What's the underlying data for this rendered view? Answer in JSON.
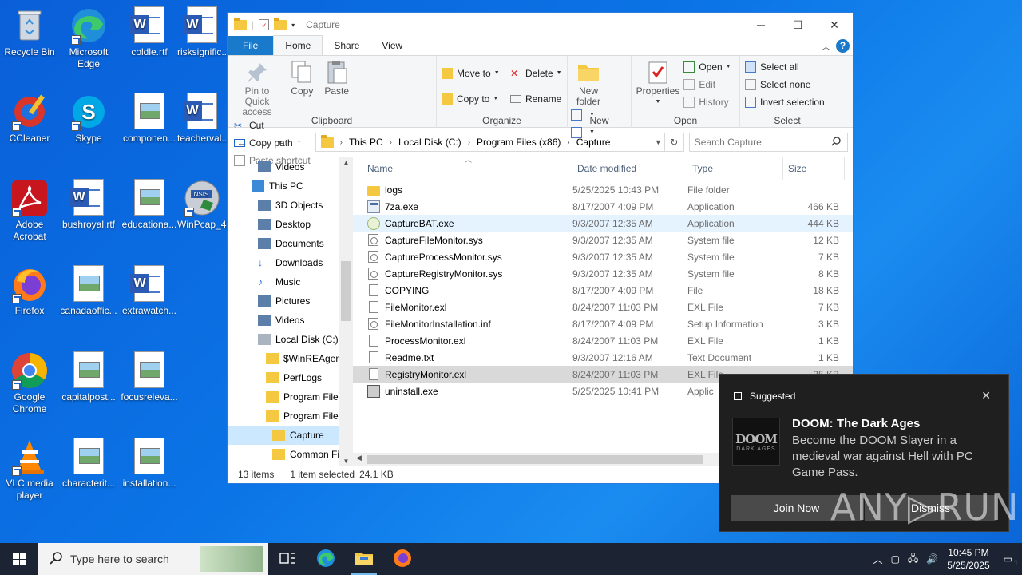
{
  "desktop": {
    "icons": [
      {
        "label": "Recycle Bin"
      },
      {
        "label": "Microsoft Edge"
      },
      {
        "label": "coldle.rtf"
      },
      {
        "label": "risksignific..."
      },
      {
        "label": "CCleaner"
      },
      {
        "label": "Skype"
      },
      {
        "label": "componen..."
      },
      {
        "label": "teacherval..."
      },
      {
        "label": "Adobe Acrobat"
      },
      {
        "label": "bushroyal.rtf"
      },
      {
        "label": "educationa..."
      },
      {
        "label": "WinPcap_4..."
      },
      {
        "label": "Firefox"
      },
      {
        "label": "canadaoffic..."
      },
      {
        "label": "extrawatch..."
      },
      {
        "label": "Google Chrome"
      },
      {
        "label": "capitalpost..."
      },
      {
        "label": "focusreleva..."
      },
      {
        "label": "VLC media player"
      },
      {
        "label": "characterit..."
      },
      {
        "label": "installation..."
      }
    ]
  },
  "explorer": {
    "title": "Capture",
    "tabs": [
      "File",
      "Home",
      "Share",
      "View"
    ],
    "ribbon": {
      "clipboard": {
        "name": "Clipboard",
        "pin": "Pin to Quick access",
        "copy": "Copy",
        "paste": "Paste",
        "cut": "Cut",
        "copy_path": "Copy path",
        "paste_shortcut": "Paste shortcut"
      },
      "organize": {
        "name": "Organize",
        "move_to": "Move to",
        "copy_to": "Copy to",
        "delete": "Delete",
        "rename": "Rename"
      },
      "new": {
        "name": "New",
        "new_folder": "New folder"
      },
      "open": {
        "name": "Open",
        "properties": "Properties",
        "open": "Open",
        "edit": "Edit",
        "history": "History"
      },
      "select": {
        "name": "Select",
        "select_all": "Select all",
        "select_none": "Select none",
        "invert": "Invert selection"
      }
    },
    "address": {
      "crumbs": [
        "This PC",
        "Local Disk (C:)",
        "Program Files (x86)",
        "Capture"
      ],
      "search_placeholder": "Search Capture"
    },
    "nav": [
      {
        "label": "Videos",
        "indent": 1
      },
      {
        "label": "This PC",
        "indent": 0
      },
      {
        "label": "3D Objects",
        "indent": 1
      },
      {
        "label": "Desktop",
        "indent": 1
      },
      {
        "label": "Documents",
        "indent": 1
      },
      {
        "label": "Downloads",
        "indent": 1
      },
      {
        "label": "Music",
        "indent": 1
      },
      {
        "label": "Pictures",
        "indent": 1
      },
      {
        "label": "Videos",
        "indent": 1
      },
      {
        "label": "Local Disk (C:)",
        "indent": 1
      },
      {
        "label": "$WinREAgent",
        "indent": 2
      },
      {
        "label": "PerfLogs",
        "indent": 2
      },
      {
        "label": "Program Files",
        "indent": 2
      },
      {
        "label": "Program Files",
        "indent": 2
      },
      {
        "label": "Capture",
        "indent": 3
      },
      {
        "label": "Common Fi",
        "indent": 3
      }
    ],
    "columns": {
      "name": "Name",
      "date": "Date modified",
      "type": "Type",
      "size": "Size"
    },
    "files": [
      {
        "name": "logs",
        "date": "5/25/2025 10:43 PM",
        "type": "File folder",
        "size": "",
        "icon": "folder"
      },
      {
        "name": "7za.exe",
        "date": "8/17/2007 4:09 PM",
        "type": "Application",
        "size": "466 KB",
        "icon": "exe"
      },
      {
        "name": "CaptureBAT.exe",
        "date": "9/3/2007 12:35 AM",
        "type": "Application",
        "size": "444 KB",
        "icon": "cap"
      },
      {
        "name": "CaptureFileMonitor.sys",
        "date": "9/3/2007 12:35 AM",
        "type": "System file",
        "size": "12 KB",
        "icon": "sys"
      },
      {
        "name": "CaptureProcessMonitor.sys",
        "date": "9/3/2007 12:35 AM",
        "type": "System file",
        "size": "7 KB",
        "icon": "sys"
      },
      {
        "name": "CaptureRegistryMonitor.sys",
        "date": "9/3/2007 12:35 AM",
        "type": "System file",
        "size": "8 KB",
        "icon": "sys"
      },
      {
        "name": "COPYING",
        "date": "8/17/2007 4:09 PM",
        "type": "File",
        "size": "18 KB",
        "icon": "page"
      },
      {
        "name": "FileMonitor.exl",
        "date": "8/24/2007 11:03 PM",
        "type": "EXL File",
        "size": "7 KB",
        "icon": "page"
      },
      {
        "name": "FileMonitorInstallation.inf",
        "date": "8/17/2007 4:09 PM",
        "type": "Setup Information",
        "size": "3 KB",
        "icon": "sys"
      },
      {
        "name": "ProcessMonitor.exl",
        "date": "8/24/2007 11:03 PM",
        "type": "EXL File",
        "size": "1 KB",
        "icon": "page"
      },
      {
        "name": "Readme.txt",
        "date": "9/3/2007 12:16 AM",
        "type": "Text Document",
        "size": "1 KB",
        "icon": "page"
      },
      {
        "name": "RegistryMonitor.exl",
        "date": "8/24/2007 11:03 PM",
        "type": "EXL File",
        "size": "35 KB",
        "icon": "page"
      },
      {
        "name": "uninstall.exe",
        "date": "5/25/2025 10:41 PM",
        "type": "Applic",
        "size": "",
        "icon": "inst"
      }
    ],
    "status": {
      "count": "13 items",
      "selected": "1 item selected",
      "size": "24.1 KB"
    }
  },
  "toast": {
    "header": "Suggested",
    "art_line1": "DOOM",
    "art_line2": "DARK AGES",
    "title": "DOOM: The Dark Ages",
    "body": "Become the DOOM Slayer in a medieval war against Hell with PC Game Pass.",
    "join": "Join Now",
    "dismiss": "Dismiss"
  },
  "watermark": "ANY▷RUN",
  "taskbar": {
    "search_placeholder": "Type here to search",
    "time": "10:45 PM",
    "date": "5/25/2025",
    "notification_count": "1"
  }
}
